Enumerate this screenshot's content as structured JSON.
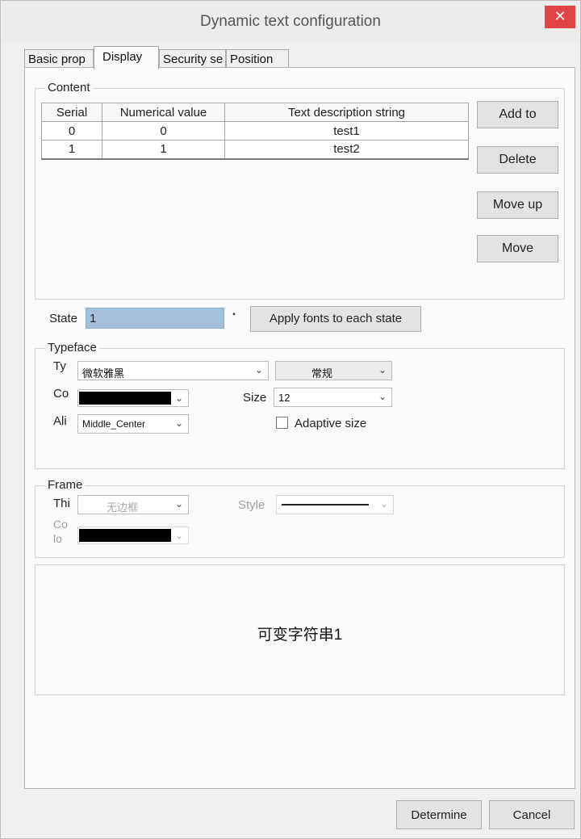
{
  "window": {
    "title": "Dynamic text configuration",
    "close_glyph": "✕"
  },
  "tabs": [
    {
      "label": "Basic prop",
      "active": false
    },
    {
      "label": "Display",
      "active": true
    },
    {
      "label": "Security se",
      "active": false
    },
    {
      "label": "Position",
      "active": false
    }
  ],
  "content": {
    "group_label": "Content",
    "columns": [
      "Serial",
      "Numerical value",
      "Text description string"
    ],
    "rows": [
      {
        "serial": "0",
        "value": "0",
        "text": "test1"
      },
      {
        "serial": "1",
        "value": "1",
        "text": "test2"
      }
    ],
    "buttons": {
      "add": "Add to",
      "delete": "Delete",
      "move_up": "Move up",
      "move": "Move"
    }
  },
  "state": {
    "label": "State",
    "value": "1",
    "arrow_glyph": "▪",
    "apply_button": "Apply fonts to each state"
  },
  "typeface": {
    "group_label": "Typeface",
    "type_label": "Ty",
    "font_value": "微软雅黑",
    "style_value": "常规",
    "color_label": "Co",
    "size_label": "Size",
    "size_value": "12",
    "align_label": "Ali",
    "align_value": "Middle_Center",
    "adaptive_label": "Adaptive size",
    "adaptive_checked": false,
    "font_color": "#000000"
  },
  "frame": {
    "group_label": "Frame",
    "thickness_label": "Thi",
    "thickness_value": "无边框",
    "style_label": "Style",
    "color_label_line1": "Co",
    "color_label_line2": "lo",
    "frame_color": "#000000"
  },
  "preview": {
    "text": "可变字符串1"
  },
  "footer": {
    "determine": "Determine",
    "cancel": "Cancel"
  },
  "icons": {
    "dropdown": "chevron-down-icon"
  },
  "colors": {
    "close": "#e04343",
    "state_highlight": "#a3bfda"
  }
}
